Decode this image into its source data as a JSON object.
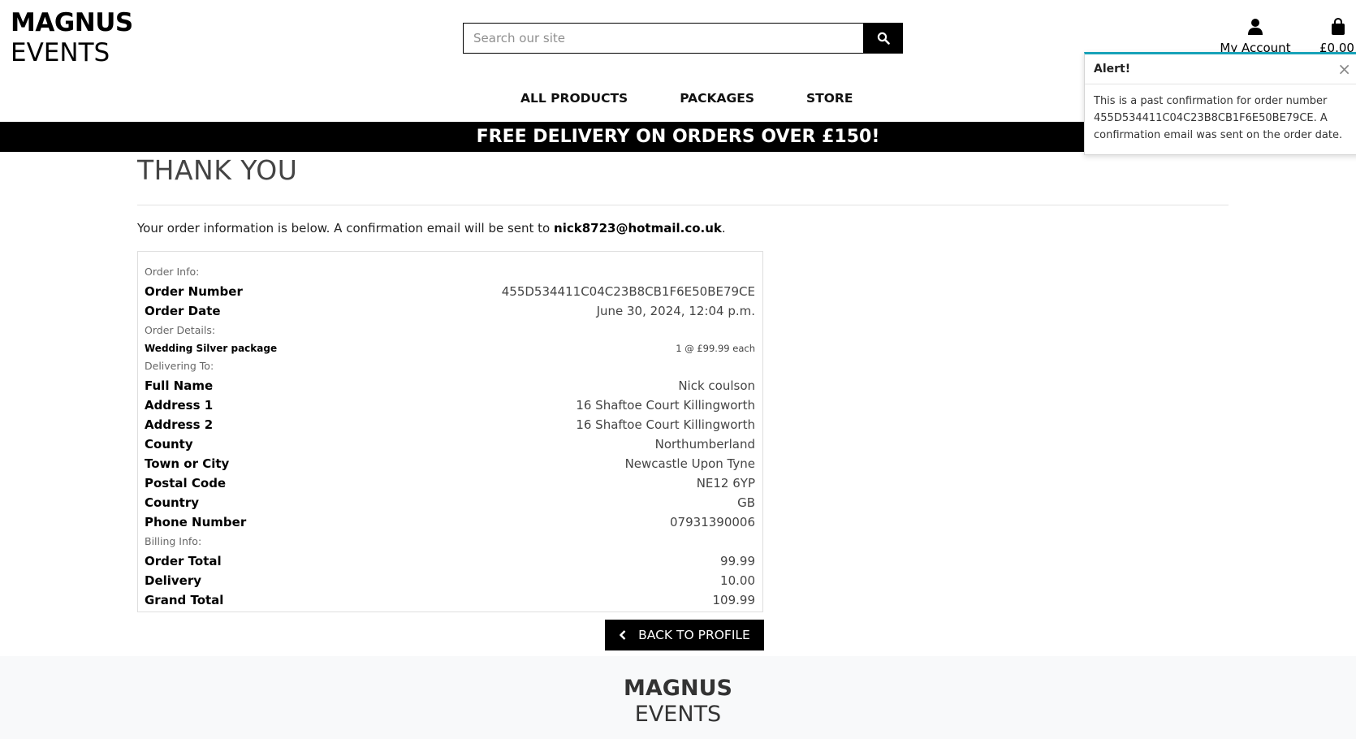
{
  "brand": {
    "line1": "MAGNUS",
    "line2": "EVENTS"
  },
  "search": {
    "placeholder": "Search our site",
    "icon": "search-icon"
  },
  "header": {
    "account_label": "My Account",
    "bag_total": "£0.00"
  },
  "nav": {
    "items": [
      "ALL PRODUCTS",
      "PACKAGES",
      "STORE"
    ]
  },
  "banner": "FREE DELIVERY ON ORDERS OVER £150!",
  "page": {
    "title": "THANK YOU",
    "intro_prefix": "Your order information is below. A confirmation email will be sent to ",
    "email": "nick8723@hotmail.co.uk",
    "intro_suffix": "."
  },
  "order": {
    "info_label": "Order Info:",
    "number_label": "Order Number",
    "number": "455D534411C04C23B8CB1F6E50BE79CE",
    "date_label": "Order Date",
    "date": "June 30, 2024, 12:04 p.m.",
    "details_label": "Order Details:",
    "item_name": "Wedding Silver package",
    "item_qty": "1 @ £99.99 each",
    "delivering_label": "Delivering To:",
    "delivery": [
      {
        "label": "Full Name",
        "value": "Nick coulson"
      },
      {
        "label": "Address 1",
        "value": "16 Shaftoe Court Killingworth"
      },
      {
        "label": "Address 2",
        "value": "16 Shaftoe Court Killingworth"
      },
      {
        "label": "County",
        "value": "Northumberland"
      },
      {
        "label": "Town or City",
        "value": "Newcastle Upon Tyne"
      },
      {
        "label": "Postal Code",
        "value": "NE12 6YP"
      },
      {
        "label": "Country",
        "value": "GB"
      },
      {
        "label": "Phone Number",
        "value": "07931390006"
      }
    ],
    "billing_label": "Billing Info:",
    "billing": [
      {
        "label": "Order Total",
        "value": "99.99"
      },
      {
        "label": "Delivery",
        "value": "10.00"
      },
      {
        "label": "Grand Total",
        "value": "109.99"
      }
    ]
  },
  "back_button": "BACK TO PROFILE",
  "footer": {
    "line1": "MAGNUS",
    "line2": "EVENTS"
  },
  "toast": {
    "title": "Alert!",
    "close": "×",
    "message": "This is a past confirmation for order number 455D534411C04C23B8CB1F6E50BE79CE. A confirmation email was sent on the order date."
  },
  "colors": {
    "accent": "#17a2b8",
    "banner_bg": "#000000",
    "footer_bg": "#f8f9fa"
  }
}
